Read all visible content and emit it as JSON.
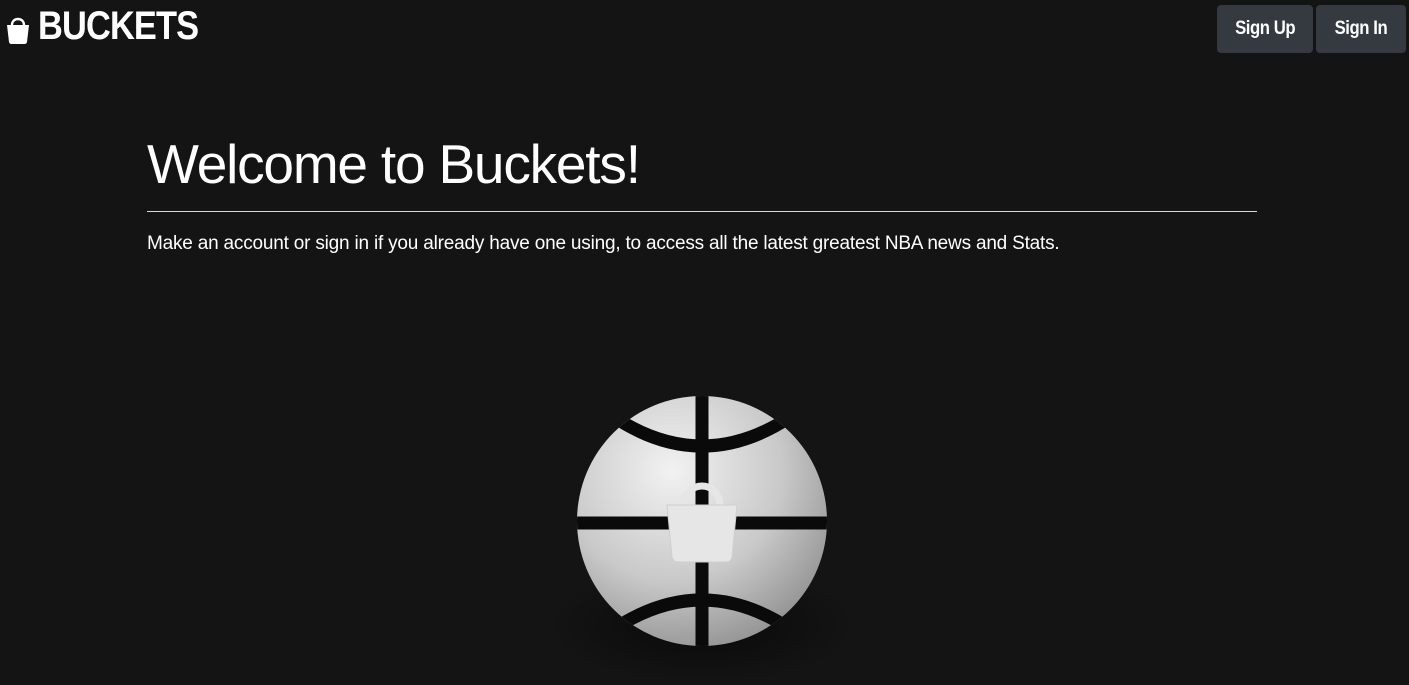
{
  "navbar": {
    "brand_icon": "bucket-icon",
    "brand_text": "BUCKETS",
    "signup_label": "Sign Up",
    "signin_label": "Sign In",
    "button_color": "#343a40"
  },
  "hero": {
    "title": "Welcome to Buckets!",
    "lead": "Make an account or sign in if you already have one using, to access all the latest greatest NBA news and Stats."
  },
  "illustration": {
    "icon": "basketball-bucket-logo-icon"
  },
  "colors": {
    "background": "#141414",
    "text": "#ffffff"
  }
}
